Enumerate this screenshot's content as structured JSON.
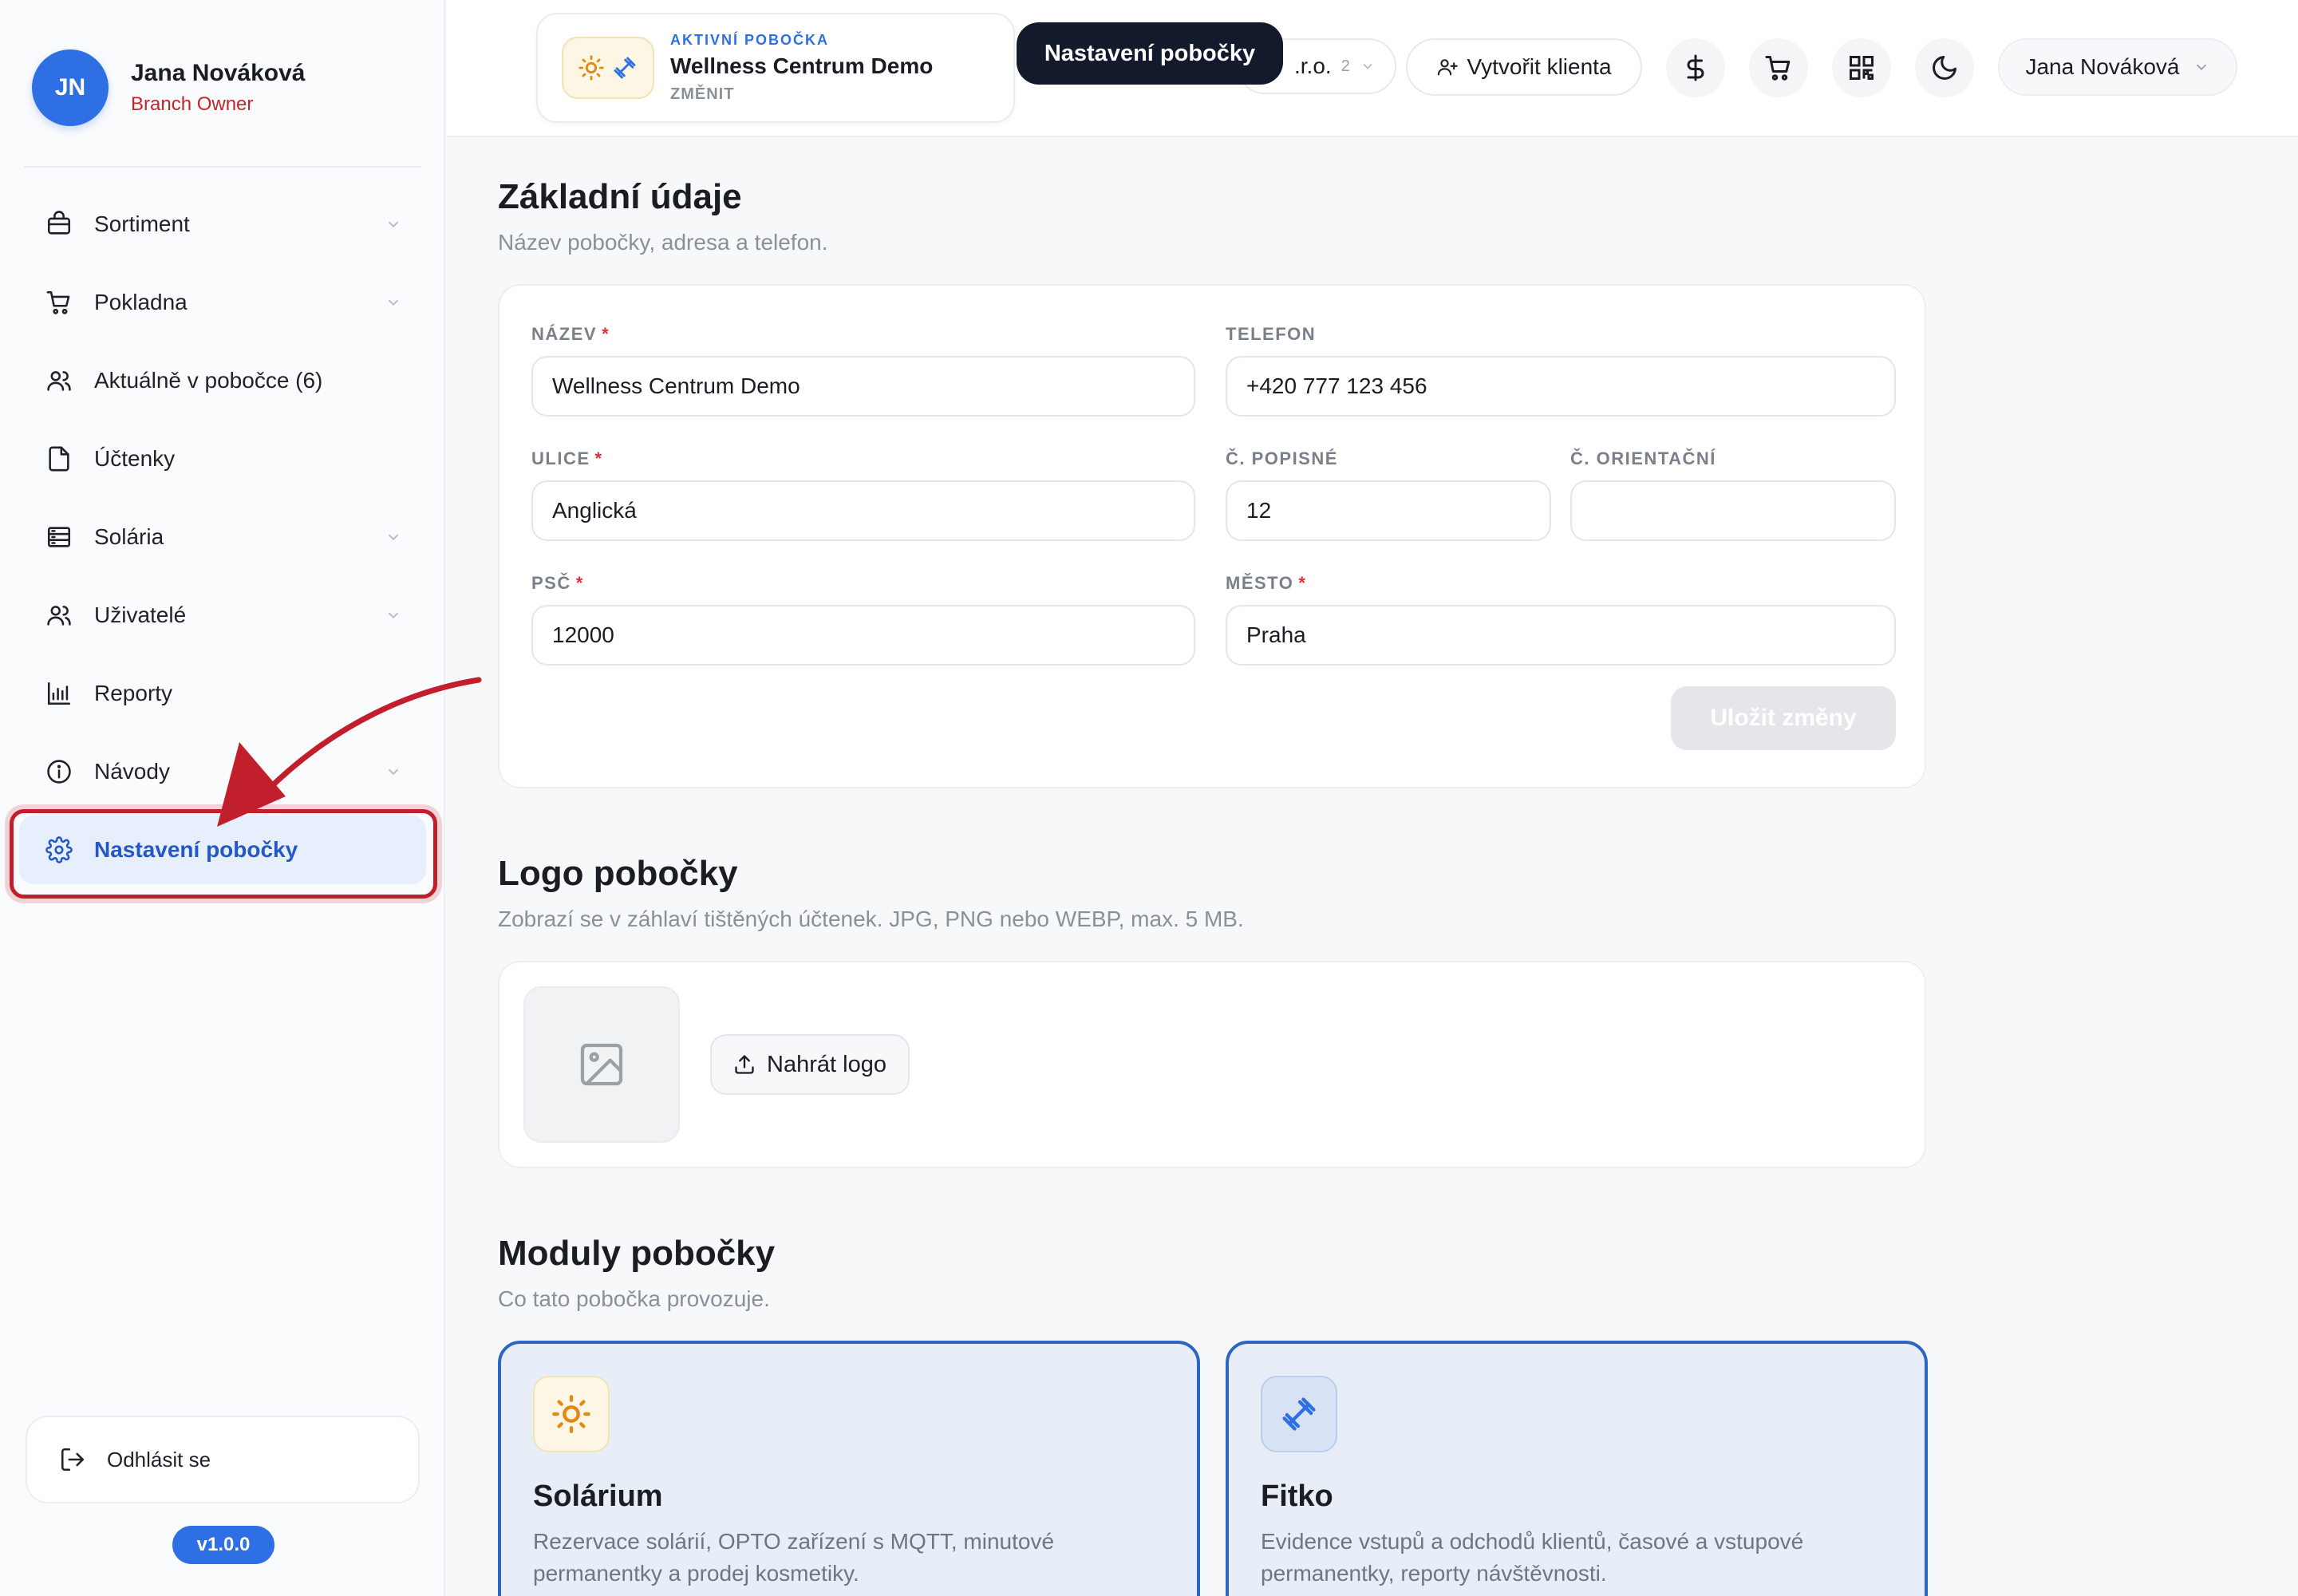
{
  "user": {
    "initials": "JN",
    "name": "Jana Nováková",
    "role": "Branch Owner"
  },
  "sidebar": {
    "items": [
      {
        "label": "Sortiment",
        "icon": "shopping-bag-icon",
        "has_chevron": true
      },
      {
        "label": "Pokladna",
        "icon": "cart-icon",
        "has_chevron": true
      },
      {
        "label": "Aktuálně v pobočce (6)",
        "icon": "users-icon",
        "has_chevron": false
      },
      {
        "label": "Účtenky",
        "icon": "file-icon",
        "has_chevron": false
      },
      {
        "label": "Solária",
        "icon": "server-icon",
        "has_chevron": true
      },
      {
        "label": "Uživatelé",
        "icon": "users-icon",
        "has_chevron": true
      },
      {
        "label": "Reporty",
        "icon": "bar-chart-icon",
        "has_chevron": false
      },
      {
        "label": "Návody",
        "icon": "info-icon",
        "has_chevron": true
      },
      {
        "label": "Nastavení pobočky",
        "icon": "gear-icon",
        "has_chevron": false,
        "active": true
      }
    ],
    "logout_label": "Odhlásit se",
    "version": "v1.0.0"
  },
  "topbar": {
    "branch_kicker": "AKTIVNÍ POBOČKA",
    "branch_name": "Wellness Centrum Demo",
    "branch_change": "ZMĚNIT",
    "tooltip": "Nastavení pobočky",
    "company_partial": ".r.o.",
    "company_count": "2",
    "create_client_label": "Vytvořit klienta",
    "user_menu_label": "Jana Nováková"
  },
  "basic": {
    "title": "Základní údaje",
    "subtitle": "Název pobočky, adresa a telefon.",
    "fields": {
      "name": {
        "label": "NÁZEV",
        "required": true,
        "value": "Wellness Centrum Demo"
      },
      "phone": {
        "label": "TELEFON",
        "required": false,
        "value": "+420 777 123 456"
      },
      "street": {
        "label": "ULICE",
        "required": true,
        "value": "Anglická"
      },
      "house_no": {
        "label": "Č. POPISNÉ",
        "required": false,
        "value": "12"
      },
      "orient_no": {
        "label": "Č. ORIENTAČNÍ",
        "required": false,
        "value": ""
      },
      "zip": {
        "label": "PSČ",
        "required": true,
        "value": "12000"
      },
      "city": {
        "label": "MĚSTO",
        "required": true,
        "value": "Praha"
      }
    },
    "save_label": "Uložit změny",
    "required_mark": "*"
  },
  "logo": {
    "title": "Logo pobočky",
    "subtitle": "Zobrazí se v záhlaví tištěných účtenek. JPG, PNG nebo WEBP, max. 5 MB.",
    "upload_label": "Nahrát logo"
  },
  "modules": {
    "title": "Moduly pobočky",
    "subtitle": "Co tato pobočka provozuje.",
    "items": [
      {
        "title": "Solárium",
        "description": "Rezervace solárií, OPTO zařízení s MQTT, minutové permanentky a prodej kosmetiky.",
        "icon": "sun-icon"
      },
      {
        "title": "Fitko",
        "description": "Evidence vstupů a odchodů klientů, časové a vstupové permanentky, reporty návštěvnosti.",
        "icon": "dumbbell-icon"
      }
    ]
  },
  "colors": {
    "accent": "#2f6fe4",
    "annotation": "#c11f2b",
    "role": "#c0262d"
  }
}
